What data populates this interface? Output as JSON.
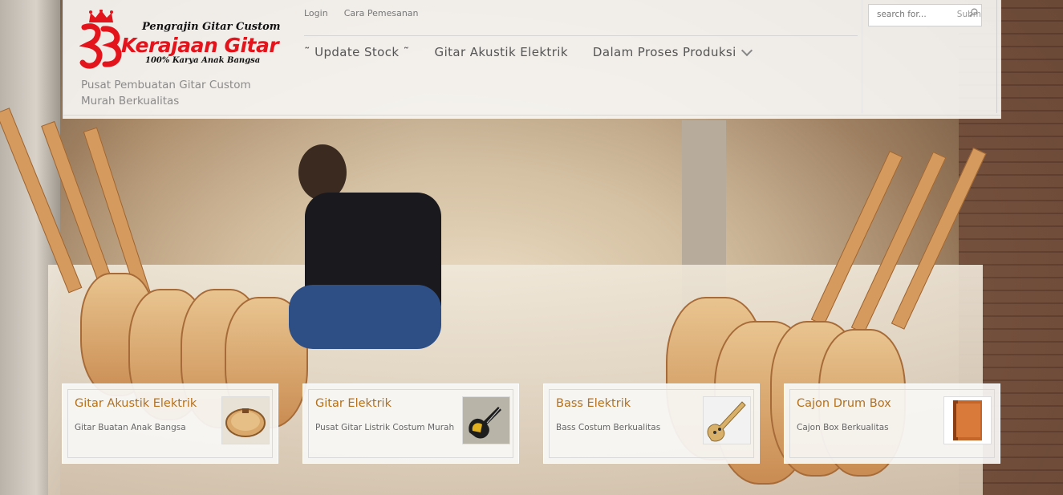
{
  "site": {
    "logo": {
      "top_text": "Pengrajin Gitar Custom",
      "brand_text": "Kerajaan Gitar",
      "sub_text": "100% Karya Anak Bangsa"
    },
    "tagline": "Pusat Pembuatan Gitar Custom Murah Berkualitas"
  },
  "toplinks": [
    {
      "label": "Login"
    },
    {
      "label": "Cara Pemesanan"
    }
  ],
  "nav": [
    {
      "label": "˜ Update Stock ˜"
    },
    {
      "label": "Gitar Akustik Elektrik"
    },
    {
      "label": "Dalam Proses Produksi"
    }
  ],
  "search": {
    "placeholder": "search for...",
    "submit_label": "Subm"
  },
  "cards": [
    {
      "title": "Gitar Akustik Elektrik",
      "desc": "Gitar Buatan Anak Bangsa",
      "thumb_icon": "acoustic-guitar-body-icon"
    },
    {
      "title": "Gitar Elektrik",
      "desc": "Pusat Gitar Listrik Costum Murah",
      "thumb_icon": "electric-guitar-icon"
    },
    {
      "title": "Bass Elektrik",
      "desc": "Bass Costum Berkualitas",
      "thumb_icon": "bass-guitar-icon"
    },
    {
      "title": "Cajon Drum Box",
      "desc": "Cajon Box Berkualitas",
      "thumb_icon": "cajon-box-icon"
    }
  ],
  "colors": {
    "brand_red": "#e3141c",
    "card_title": "#b5701b",
    "nav_text": "#555555"
  }
}
